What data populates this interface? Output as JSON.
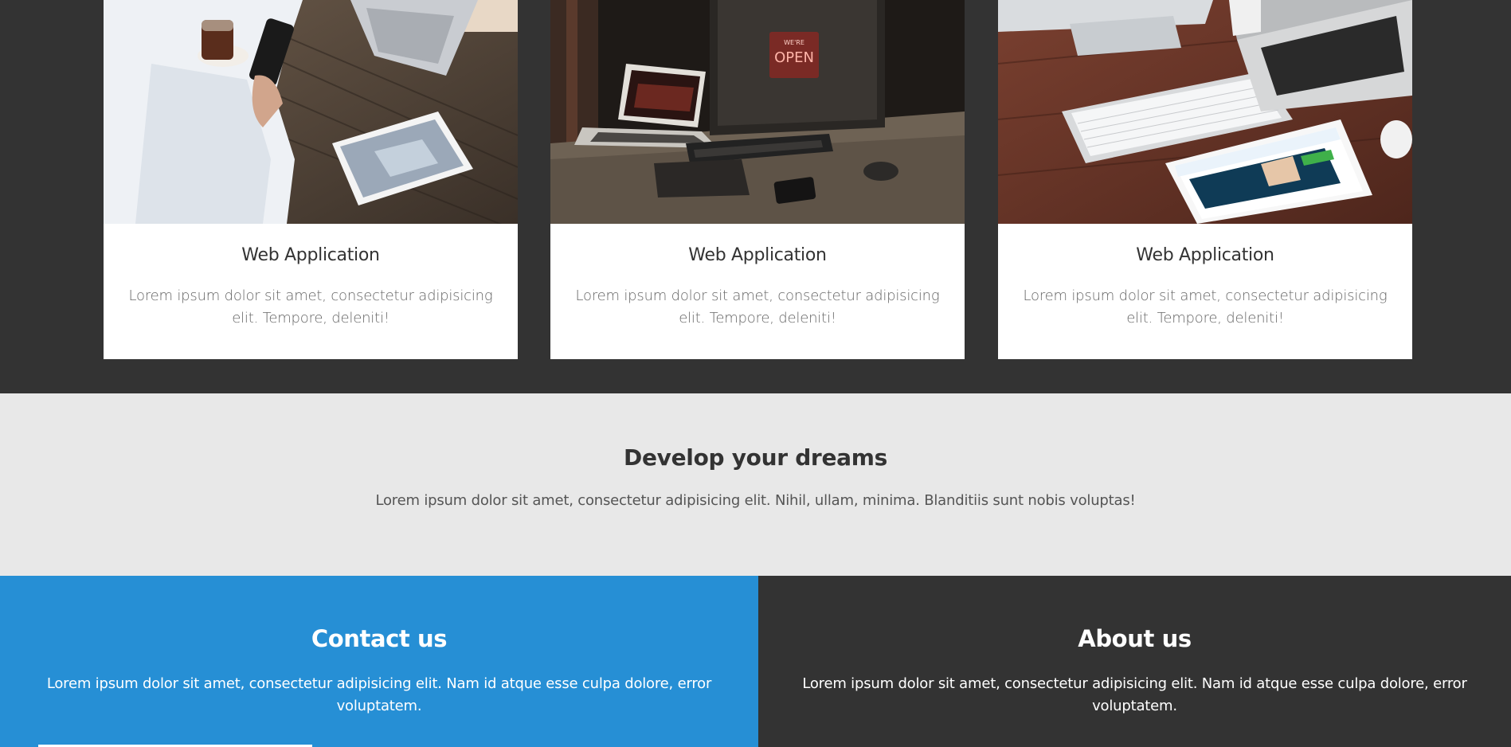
{
  "cards": [
    {
      "title": "Web Application",
      "description": "Lorem ipsum dolor sit amet, consectetur adipisicing elit. Tempore, deleniti!",
      "image_icon": "coworkers-laptop-tablet-photo"
    },
    {
      "title": "Web Application",
      "description": "Lorem ipsum dolor sit amet, consectetur adipisicing elit. Tempore, deleniti!",
      "image_icon": "laptop-monitor-dark-desk-photo"
    },
    {
      "title": "Web Application",
      "description": "Lorem ipsum dolor sit amet, consectetur adipisicing elit. Tempore, deleniti!",
      "image_icon": "imac-keyboard-ipad-photo"
    }
  ],
  "dreams": {
    "heading": "Develop your dreams",
    "text": "Lorem ipsum dolor sit amet, consectetur adipisicing elit. Nihil, ullam, minima. Blanditiis sunt nobis voluptas!"
  },
  "contact": {
    "title": "Contact us",
    "text": "Lorem ipsum dolor sit amet, consectetur adipisicing elit. Nam id atque esse culpa dolore, error voluptatem."
  },
  "about": {
    "title": "About us",
    "text": "Lorem ipsum dolor sit amet, consectetur adipisicing elit. Nam id atque esse culpa dolore, error voluptatem."
  },
  "colors": {
    "dark_bg": "#333333",
    "light_bg": "#e8e8e8",
    "accent_blue": "#268fd5",
    "card_bg": "#ffffff"
  }
}
